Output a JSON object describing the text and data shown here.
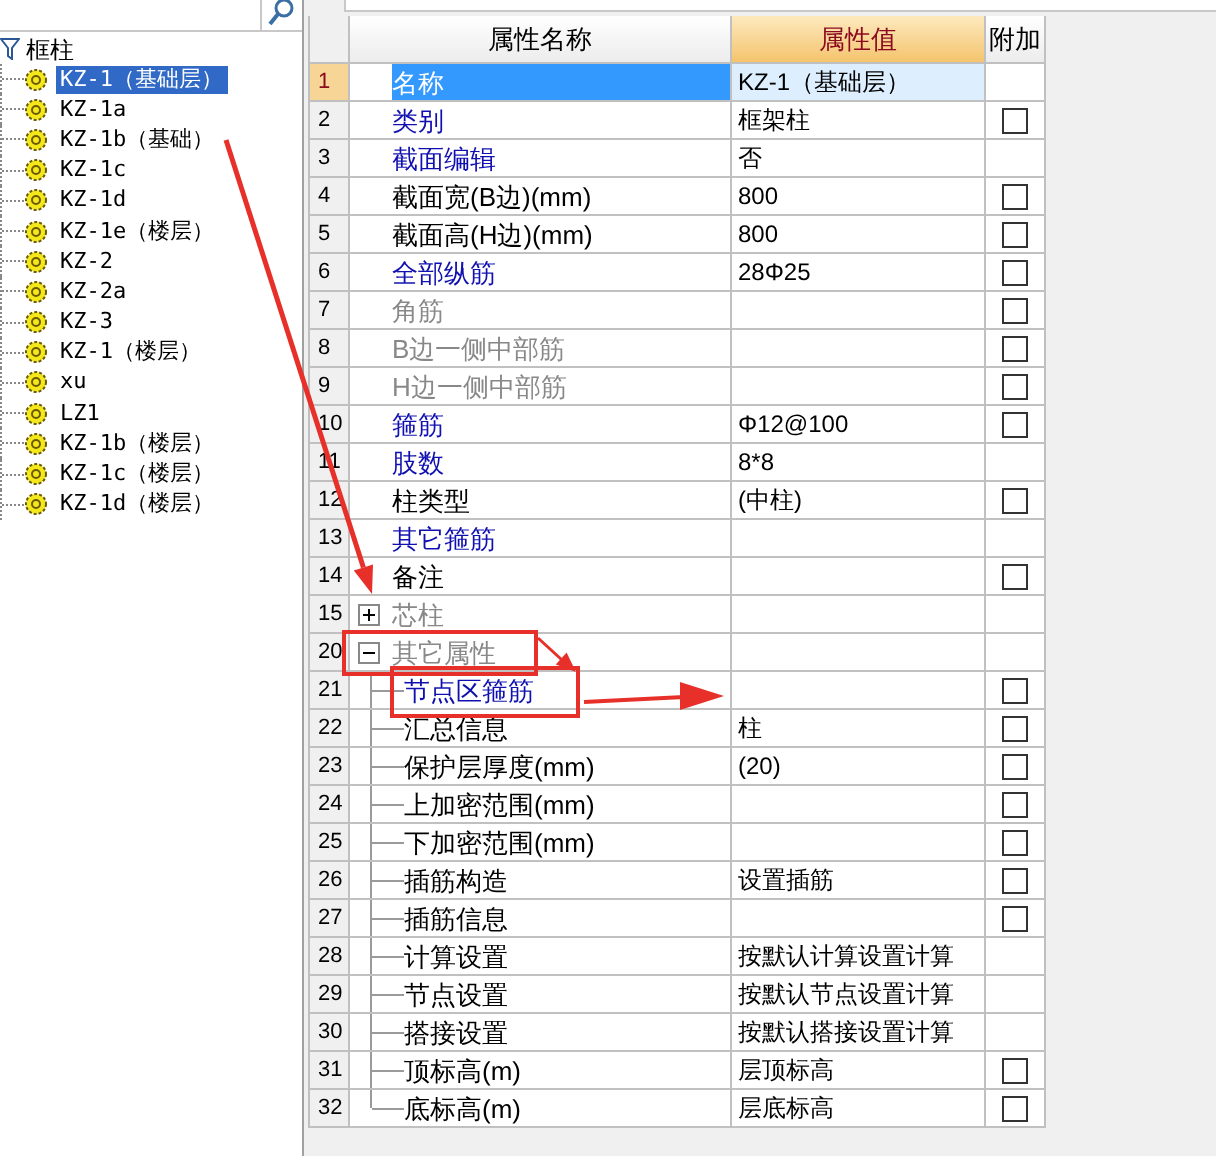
{
  "tree": {
    "root": "框柱",
    "items": [
      {
        "label": "KZ-1（基础层）",
        "selected": true
      },
      {
        "label": "KZ-1a",
        "selected": false
      },
      {
        "label": "KZ-1b（基础）",
        "selected": false
      },
      {
        "label": "KZ-1c",
        "selected": false
      },
      {
        "label": "KZ-1d",
        "selected": false
      },
      {
        "label": "KZ-1e（楼层）",
        "selected": false
      },
      {
        "label": "KZ-2",
        "selected": false
      },
      {
        "label": "KZ-2a",
        "selected": false
      },
      {
        "label": "KZ-3",
        "selected": false
      },
      {
        "label": "KZ-1（楼层）",
        "selected": false
      },
      {
        "label": "xu",
        "selected": false
      },
      {
        "label": "LZ1",
        "selected": false
      },
      {
        "label": "KZ-1b（楼层）",
        "selected": false
      },
      {
        "label": "KZ-1c（楼层）",
        "selected": false
      },
      {
        "label": "KZ-1d（楼层）",
        "selected": false
      }
    ]
  },
  "table": {
    "columns": [
      "属性名称",
      "属性值",
      "附加"
    ],
    "rows": [
      {
        "num": "1",
        "name": "名称",
        "value": "KZ-1（基础层）",
        "kind": "property",
        "selected": true
      },
      {
        "num": "2",
        "name": "类别",
        "value": "框架柱",
        "kind": "property",
        "color": "#1010b0",
        "selected": false,
        "checked": false
      },
      {
        "num": "3",
        "name": "截面编辑",
        "value": "否",
        "kind": "property",
        "color": "#1010b0",
        "selected": false
      },
      {
        "num": "4",
        "name": "截面宽(B边)(mm)",
        "value": "800",
        "kind": "property",
        "color": "#000000",
        "selected": false,
        "checked": false
      },
      {
        "num": "5",
        "name": "截面高(H边)(mm)",
        "value": "800",
        "kind": "property",
        "color": "#000000",
        "selected": false,
        "checked": false
      },
      {
        "num": "6",
        "name": "全部纵筋",
        "value": "28Φ25",
        "kind": "property",
        "color": "#1010b0",
        "selected": false,
        "checked": false
      },
      {
        "num": "7",
        "name": "角筋",
        "kind": "property",
        "color": "#888888",
        "selected": false,
        "checked": false
      },
      {
        "num": "8",
        "name": "B边一侧中部筋",
        "kind": "property",
        "color": "#888888",
        "selected": false,
        "checked": false
      },
      {
        "num": "9",
        "name": "H边一侧中部筋",
        "kind": "property",
        "color": "#888888",
        "selected": false,
        "checked": false
      },
      {
        "num": "10",
        "name": "箍筋",
        "value": "Φ12@100",
        "kind": "property",
        "color": "#1010b0",
        "selected": false,
        "checked": false
      },
      {
        "num": "11",
        "name": "肢数",
        "value": "8*8",
        "kind": "property",
        "color": "#1010b0",
        "selected": false
      },
      {
        "num": "12",
        "name": "柱类型",
        "value": "(中柱)",
        "kind": "property",
        "color": "#000000",
        "selected": false,
        "checked": false
      },
      {
        "num": "13",
        "name": "其它箍筋",
        "kind": "property",
        "color": "#1010b0",
        "selected": false
      },
      {
        "num": "14",
        "name": "备注",
        "kind": "property",
        "color": "#000000",
        "selected": false,
        "checked": false
      },
      {
        "num": "15",
        "name": "芯柱",
        "kind": "group",
        "color": "#888888",
        "selected": false,
        "expanded": false
      },
      {
        "num": "20",
        "name": "其它属性",
        "kind": "group",
        "color": "#888888",
        "selected": false,
        "expanded": true,
        "children": [
          {
            "num": "21",
            "name": "节点区箍筋",
            "color": "#1010b0",
            "selected": false,
            "checked": false
          },
          {
            "num": "22",
            "name": "汇总信息",
            "value": "柱",
            "color": "#000000",
            "selected": false,
            "checked": false
          },
          {
            "num": "23",
            "name": "保护层厚度(mm)",
            "value": "(20)",
            "color": "#000000",
            "selected": false,
            "checked": false
          },
          {
            "num": "24",
            "name": "上加密范围(mm)",
            "color": "#000000",
            "selected": false,
            "checked": false
          },
          {
            "num": "25",
            "name": "下加密范围(mm)",
            "color": "#000000",
            "selected": false,
            "checked": false
          },
          {
            "num": "26",
            "name": "插筋构造",
            "value": "设置插筋",
            "color": "#000000",
            "selected": false,
            "checked": false
          },
          {
            "num": "27",
            "name": "插筋信息",
            "color": "#000000",
            "selected": false,
            "checked": false
          },
          {
            "num": "28",
            "name": "计算设置",
            "value": "按默认计算设置计算",
            "color": "#000000",
            "selected": false
          },
          {
            "num": "29",
            "name": "节点设置",
            "value": "按默认节点设置计算",
            "color": "#000000",
            "selected": false
          },
          {
            "num": "30",
            "name": "搭接设置",
            "value": "按默认搭接设置计算",
            "color": "#000000",
            "selected": false
          },
          {
            "num": "31",
            "name": "顶标高(m)",
            "value": "层顶标高",
            "color": "#000000",
            "selected": false,
            "checked": false
          },
          {
            "num": "32",
            "name": "底标高(m)",
            "value": "层底标高",
            "color": "#000000",
            "selected": false,
            "checked": false
          }
        ]
      }
    ]
  }
}
